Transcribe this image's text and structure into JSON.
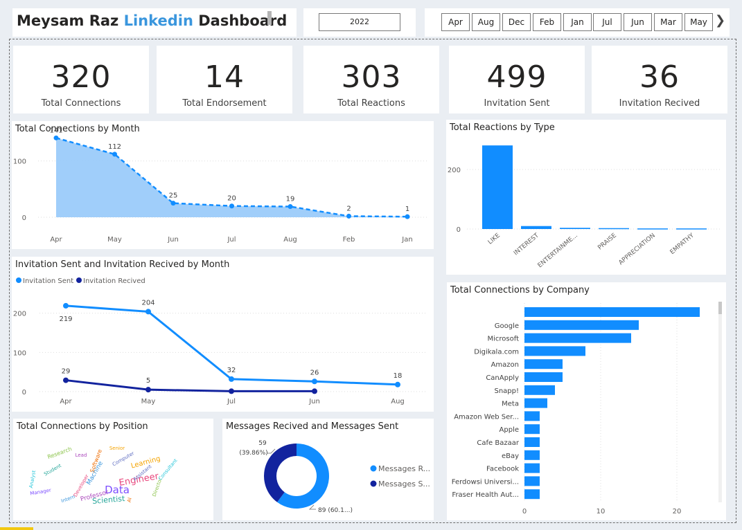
{
  "header": {
    "title_part1": "Meysam Raz ",
    "title_accent": "Linkedin",
    "title_part2": " Dashboard",
    "year": "2022",
    "months": [
      "Apr",
      "Aug",
      "Dec",
      "Feb",
      "Jan",
      "Jul",
      "Jun",
      "Mar",
      "May"
    ]
  },
  "kpis": [
    {
      "value": "320",
      "label": "Total Connections"
    },
    {
      "value": "14",
      "label": "Total Endorsement"
    },
    {
      "value": "303",
      "label": "Total Reactions"
    },
    {
      "value": "499",
      "label": "Invitation Sent"
    },
    {
      "value": "36",
      "label": "Invitation Recived"
    }
  ],
  "colors": {
    "primary": "#118dff",
    "dark": "#12239e",
    "area": "#9bcbfa"
  },
  "chart_data": [
    {
      "id": "connections_by_month",
      "type": "area",
      "title": "Total Connections by Month",
      "categories": [
        "Apr",
        "May",
        "Jun",
        "Jul",
        "Aug",
        "Feb",
        "Jan"
      ],
      "values": [
        141,
        112,
        25,
        20,
        19,
        2,
        1
      ],
      "yticks": [
        0,
        100
      ],
      "ylim": [
        0,
        150
      ]
    },
    {
      "id": "reactions_by_type",
      "type": "bar",
      "title": "Total Reactions by Type",
      "categories": [
        "LIKE",
        "INTEREST",
        "ENTERTAINME...",
        "PRAISE",
        "APPRECIATION",
        "EMPATHY"
      ],
      "values": [
        281,
        10,
        4,
        3,
        2,
        2
      ],
      "yticks": [
        0,
        200
      ],
      "ylim": [
        0,
        300
      ]
    },
    {
      "id": "invitations_by_month",
      "type": "line",
      "title": "Invitation Sent and Invitation Recived by Month",
      "series": [
        {
          "name": "Invitation Sent",
          "categories": [
            "Apr",
            "May",
            "Jul",
            "Jun",
            "Aug"
          ],
          "values": [
            219,
            204,
            32,
            26,
            18
          ]
        },
        {
          "name": "Invitation Recived",
          "categories": [
            "Apr",
            "May",
            "Jul",
            "Jun"
          ],
          "values": [
            29,
            5,
            1,
            1
          ]
        }
      ],
      "x_labels": [
        "Apr",
        "May",
        "Jul",
        "Jun",
        "Aug"
      ],
      "yticks": [
        0,
        100,
        200
      ],
      "ylim": [
        0,
        240
      ],
      "legend": "top-left"
    },
    {
      "id": "connections_by_company",
      "type": "bar",
      "orientation": "horizontal",
      "title": "Total Connections by Company",
      "categories": [
        "",
        "Google",
        "Microsoft",
        "Digikala.com",
        "Amazon",
        "CanApply",
        "Snapp!",
        "Meta",
        "Amazon Web Ser...",
        "Apple",
        "Cafe Bazaar",
        "eBay",
        "Facebook",
        "Ferdowsi Universi...",
        "Fraser Health Aut..."
      ],
      "values": [
        23,
        15,
        14,
        8,
        5,
        5,
        4,
        3,
        2,
        2,
        2,
        2,
        2,
        2,
        2
      ],
      "xticks": [
        0,
        10,
        20
      ],
      "xlim": [
        0,
        25
      ]
    },
    {
      "id": "messages",
      "type": "pie",
      "title": "Messages Recived and Messages Sent",
      "labels": [
        "Messages R...",
        "Messages S..."
      ],
      "values": [
        89,
        59
      ],
      "data_labels": [
        "89 (60.1...)",
        "59\n(39.86%)"
      ]
    }
  ],
  "wordcloud": {
    "title": "Total Connections by Position",
    "words": [
      "Engineer",
      "Data",
      "Scientist",
      "Learning",
      "Machine",
      "Research",
      "Professor",
      "Software",
      "Assistant",
      "Analyst",
      "Developer",
      "Manager",
      "Student",
      "Senior",
      "Intern",
      "Director",
      "Lead",
      "AI",
      "Computer",
      "Consultant"
    ]
  }
}
